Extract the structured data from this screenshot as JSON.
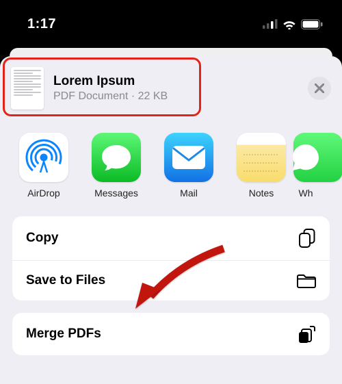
{
  "status": {
    "time": "1:17"
  },
  "document": {
    "title": "Lorem Ipsum",
    "subtitle": "PDF Document · 22 KB"
  },
  "activities": {
    "airdrop": "AirDrop",
    "messages": "Messages",
    "mail": "Mail",
    "notes": "Notes",
    "whatsapp": "Wh"
  },
  "actions": {
    "copy": "Copy",
    "saveToFiles": "Save to Files",
    "mergePdfs": "Merge PDFs"
  }
}
